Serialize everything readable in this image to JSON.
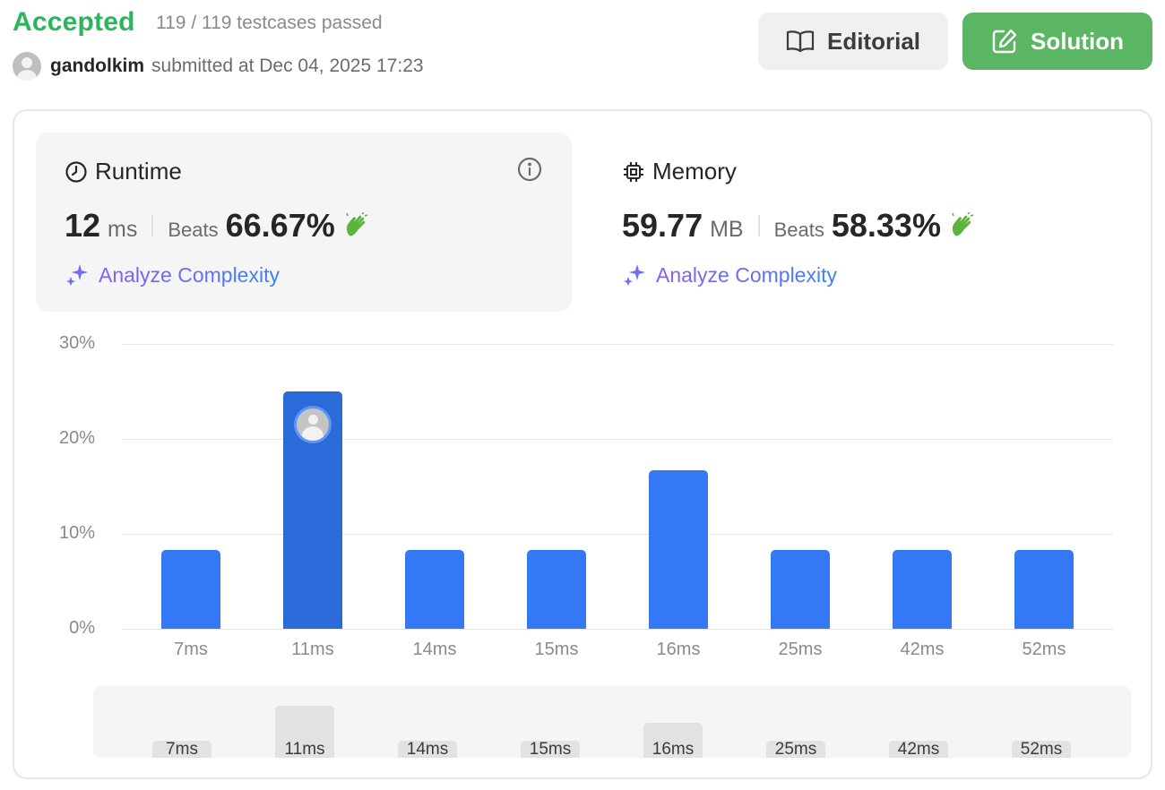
{
  "header": {
    "status": "Accepted",
    "testcases": "119 / 119 testcases passed",
    "username": "gandolkim",
    "submitted": "submitted at Dec 04, 2025 17:23",
    "editorial_label": "Editorial",
    "solution_label": "Solution"
  },
  "runtime": {
    "title": "Runtime",
    "value": "12",
    "unit": "ms",
    "beats_label": "Beats",
    "beats_value": "66.67%",
    "analyze_label": "Analyze Complexity"
  },
  "memory": {
    "title": "Memory",
    "value": "59.77",
    "unit": "MB",
    "beats_label": "Beats",
    "beats_value": "58.33%",
    "analyze_label": "Analyze Complexity"
  },
  "colors": {
    "accepted": "#2db55d",
    "bar": "#3578f6",
    "bar_active": "#2a6ad9",
    "solution_button": "#5bb663"
  },
  "chart_data": {
    "type": "bar",
    "categories": [
      "7ms",
      "11ms",
      "14ms",
      "15ms",
      "16ms",
      "25ms",
      "42ms",
      "52ms"
    ],
    "values": [
      8.33,
      25.0,
      8.33,
      8.33,
      16.67,
      8.33,
      8.33,
      8.33
    ],
    "highlighted_category": "11ms",
    "yticks": [
      "30%",
      "20%",
      "10%",
      "0%"
    ],
    "ylim": [
      0,
      30
    ],
    "grid": true
  },
  "mini_chart": {
    "labels": [
      "7ms",
      "11ms",
      "14ms",
      "15ms",
      "16ms",
      "25ms",
      "42ms",
      "52ms"
    ]
  }
}
